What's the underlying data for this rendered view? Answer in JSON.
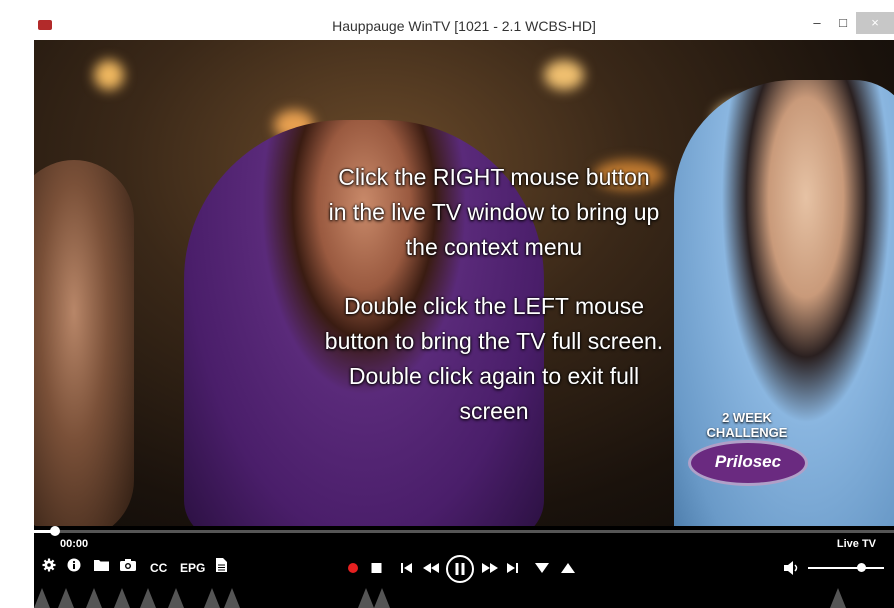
{
  "window": {
    "title": "Hauppauge WinTV [1021 - 2.1  WCBS-HD]",
    "minimize_glyph": "–",
    "maximize_glyph": "□",
    "close_glyph": "×"
  },
  "video": {
    "overlay_lines_1": [
      "Click the RIGHT mouse button",
      "in the live TV window to bring up",
      "the context menu"
    ],
    "overlay_lines_2": [
      "Double click the LEFT mouse",
      "button to bring the TV full screen.",
      "Double click again to exit full",
      "screen"
    ],
    "ad": {
      "week_label": "2 WEEK CHALLENGE",
      "brand": "Prilosec"
    }
  },
  "controls": {
    "time": "00:00",
    "mode": "Live TV",
    "seek_progress": 0.024,
    "volume_level": 0.7,
    "left_tools": [
      {
        "name": "settings-button",
        "icon": "gear-icon"
      },
      {
        "name": "info-button",
        "icon": "info-icon"
      },
      {
        "name": "open-folder-button",
        "icon": "folder-icon"
      },
      {
        "name": "snapshot-button",
        "icon": "camera-icon"
      },
      {
        "name": "closed-captions-button",
        "label": "CC"
      },
      {
        "name": "epg-button",
        "label": "EPG"
      },
      {
        "name": "notes-button",
        "icon": "document-icon"
      }
    ],
    "playback": [
      "record-icon",
      "stop-icon",
      "skip-back-icon",
      "rewind-icon",
      "pause-icon",
      "fast-forward-icon",
      "skip-forward-icon",
      "channel-down-icon",
      "channel-up-icon"
    ],
    "colors": {
      "record": "#e62020",
      "bar_bg": "#000000",
      "accent": "#ffffff"
    }
  }
}
